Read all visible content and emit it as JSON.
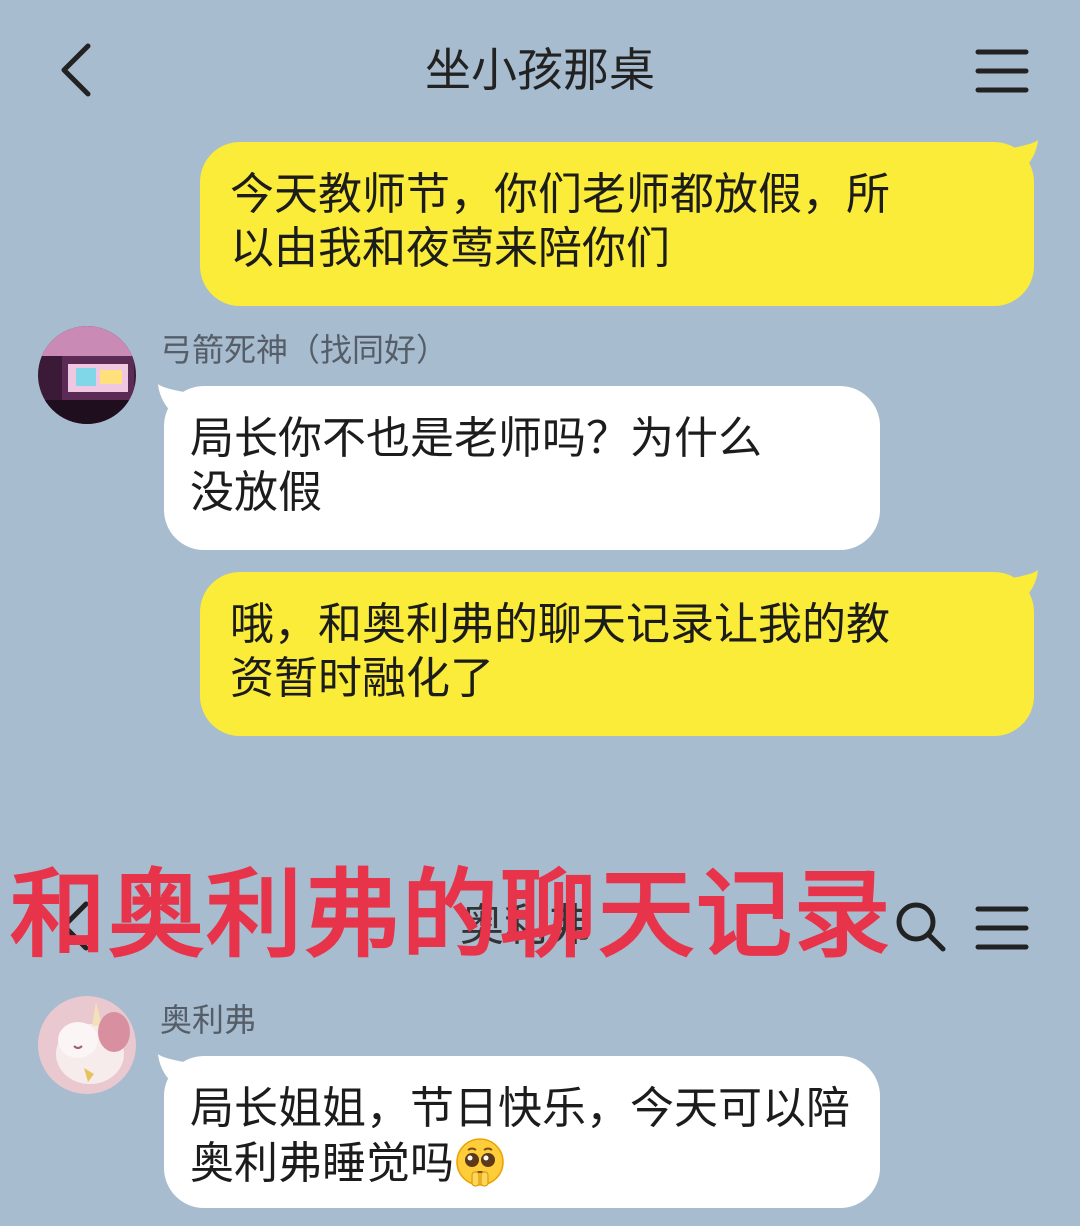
{
  "header": {
    "title": "坐小孩那桌",
    "back_icon": "chevron-left-icon",
    "menu_icon": "hamburger-menu-icon"
  },
  "messages": [
    {
      "side": "out",
      "line1": "今天教师节，你们老师都放假，所",
      "line2": "以由我和夜莺来陪你们"
    },
    {
      "side": "in",
      "sender": "弓箭死神（找同好）",
      "line1": "局长你不也是老师吗？为什么",
      "line2": "没放假"
    },
    {
      "side": "out",
      "line1": "哦，和奥利弗的聊天记录让我的教",
      "line2": "资暂时融化了"
    }
  ],
  "overlay": {
    "caption": "和奥利弗的聊天记录"
  },
  "embedded_chat": {
    "title": "奥利弗",
    "back_icon": "chevron-left-icon",
    "search_icon": "search-icon",
    "menu_icon": "hamburger-menu-icon",
    "message": {
      "sender": "奥利弗",
      "line1": "局长姐姐，节日快乐，今天可以陪",
      "line2": "奥利弗睡觉吗",
      "emoji": "pleading-face-emoji"
    }
  },
  "colors": {
    "background": "#a8bccf",
    "outgoing_bubble": "#fbec3a",
    "incoming_bubble": "#ffffff",
    "overlay_text": "#e8344a"
  }
}
